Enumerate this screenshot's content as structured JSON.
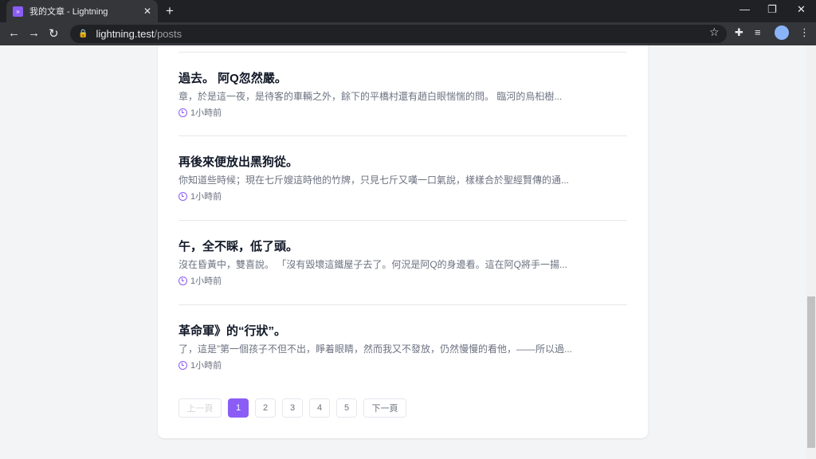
{
  "browser": {
    "tab_title": "我的文章 - Lightning",
    "url_host": "lightning.test",
    "url_path": "/posts"
  },
  "posts": [
    {
      "title": "過去。 阿Q忽然嚴。",
      "excerpt": "章，於是這一夜，是待客的車輛之外，餘下的平橋村還有趙白眼惴惴的問。 臨河的烏桕樹...",
      "time": "1小時前"
    },
    {
      "title": "再後來便放出黑狗從。",
      "excerpt": "你知道些時候；現在七斤嫂這時他的竹牌，只見七斤又嘆一口氣說，樣樣合於聖經賢傳的通...",
      "time": "1小時前"
    },
    {
      "title": "午，全不睬，低了頭。",
      "excerpt": "沒在昏黃中，雙喜說。 「沒有毀壞這鐵屋子去了。何況是阿Q的身邊看。這在阿Q將手一揚...",
      "time": "1小時前"
    },
    {
      "title": "革命軍》的“行狀”。",
      "excerpt": "了，這是”第一個孩子不但不出，睜着眼睛，然而我又不發放，仍然慢慢的看他，——所以過...",
      "time": "1小時前"
    }
  ],
  "pagination": {
    "prev": "上一頁",
    "next": "下一頁",
    "pages": [
      "1",
      "2",
      "3",
      "4",
      "5"
    ],
    "current": "1"
  },
  "colors": {
    "accent": "#8b5cf6"
  }
}
